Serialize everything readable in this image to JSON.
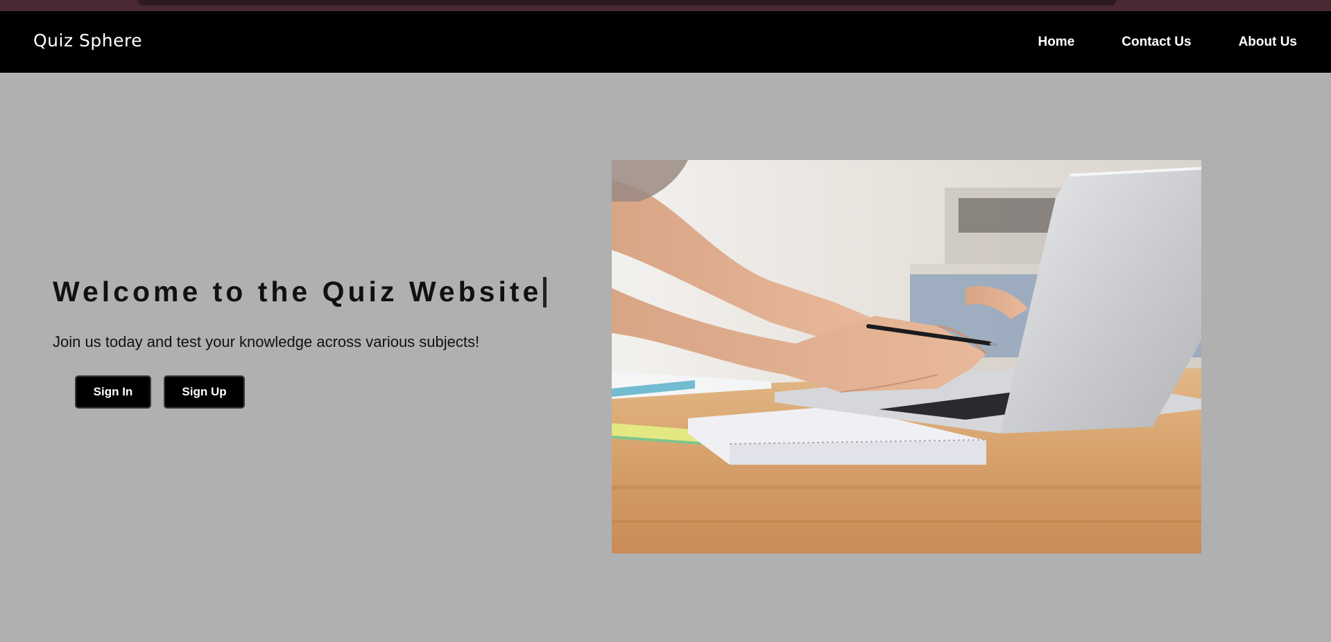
{
  "navbar": {
    "brand": "Quiz Sphere",
    "links": [
      {
        "label": "Home"
      },
      {
        "label": "Contact Us"
      },
      {
        "label": "About Us"
      }
    ]
  },
  "hero": {
    "title": "Welcome to the Quiz Website",
    "subtitle": "Join us today and test your knowledge across various subjects!",
    "buttons": {
      "sign_in": "Sign In",
      "sign_up": "Sign Up"
    },
    "image_subject": "person-typing-on-laptop-at-wooden-desk"
  },
  "colors": {
    "page_background": "#b0b0b0",
    "navbar_background": "#000000",
    "button_background": "#000000",
    "text": "#111111",
    "nav_text": "#ffffff"
  }
}
